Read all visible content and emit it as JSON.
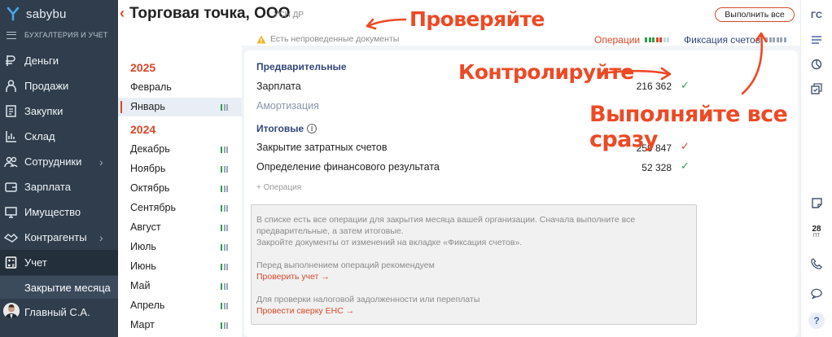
{
  "sidebar": {
    "logo": "sabybu",
    "section": "БУХГАЛТЕРИЯ И УЧЕТ",
    "items": [
      {
        "label": "Деньги"
      },
      {
        "label": "Продажи"
      },
      {
        "label": "Закупки"
      },
      {
        "label": "Склад"
      },
      {
        "label": "Сотрудники"
      },
      {
        "label": "Зарплата"
      },
      {
        "label": "Имущество"
      },
      {
        "label": "Контрагенты"
      },
      {
        "label": "Учет"
      }
    ],
    "sub_item": "Закрытие месяца",
    "user": "Главный С.А."
  },
  "header": {
    "title": "Торговая точка, ООО",
    "tax_mode": "УСН ДР",
    "warning": "Есть непроведенные документы",
    "execute_all": "Выполнить все",
    "tabs": [
      {
        "label": "Операции",
        "active": true
      },
      {
        "label": "Фиксация счетов",
        "active": false
      }
    ]
  },
  "months": {
    "year_2025": "2025",
    "year_2024": "2024",
    "list_2025": [
      {
        "label": "Февраль"
      },
      {
        "label": "Январь",
        "selected": true
      }
    ],
    "list_2024": [
      {
        "label": "Декабрь"
      },
      {
        "label": "Ноябрь"
      },
      {
        "label": "Октябрь"
      },
      {
        "label": "Сентябрь"
      },
      {
        "label": "Август"
      },
      {
        "label": "Июль"
      },
      {
        "label": "Июнь"
      },
      {
        "label": "Май"
      },
      {
        "label": "Апрель"
      },
      {
        "label": "Март"
      }
    ]
  },
  "operations": {
    "preliminary_title": "Предварительные",
    "salary": {
      "label": "Зарплата",
      "value": "216 362",
      "status": "done"
    },
    "amortization": {
      "label": "Амортизация"
    },
    "final_title": "Итоговые",
    "closing_costs": {
      "label": "Закрытие затратных счетов",
      "value": "259 847",
      "status": "pending"
    },
    "financial_result": {
      "label": "Определение финансового результата",
      "value": "52 328",
      "status": "done"
    },
    "add_operation": "+ Операция"
  },
  "info": {
    "line1": "В списке есть все операции для закрытия месяца вашей организации. Сначала выполните все предварительные, а затем итоговые.",
    "line2": "Закройте документы от изменений на вкладке «Фиксация счетов».",
    "recommend": "Перед выполнением операций рекомендуем",
    "check_link": "Проверить учет →",
    "tax_check": "Для проверки налоговой задолженности или переплаты",
    "ens_link": "Провести сверку ЕНС →"
  },
  "annotations": {
    "check": "Проверяйте",
    "control": "Контролируйте",
    "execute": "Выполняйте все сразу"
  },
  "right_bar": {
    "top_label": "ГС",
    "calendar_day": "28",
    "calendar_weekday": "ПТ",
    "help": "?"
  },
  "colors": {
    "accent": "#d8482a",
    "sidebar": "#2f3d4c",
    "annotation": "#ec4a25",
    "ok": "#2e9e4a",
    "pending": "#d8482a"
  }
}
